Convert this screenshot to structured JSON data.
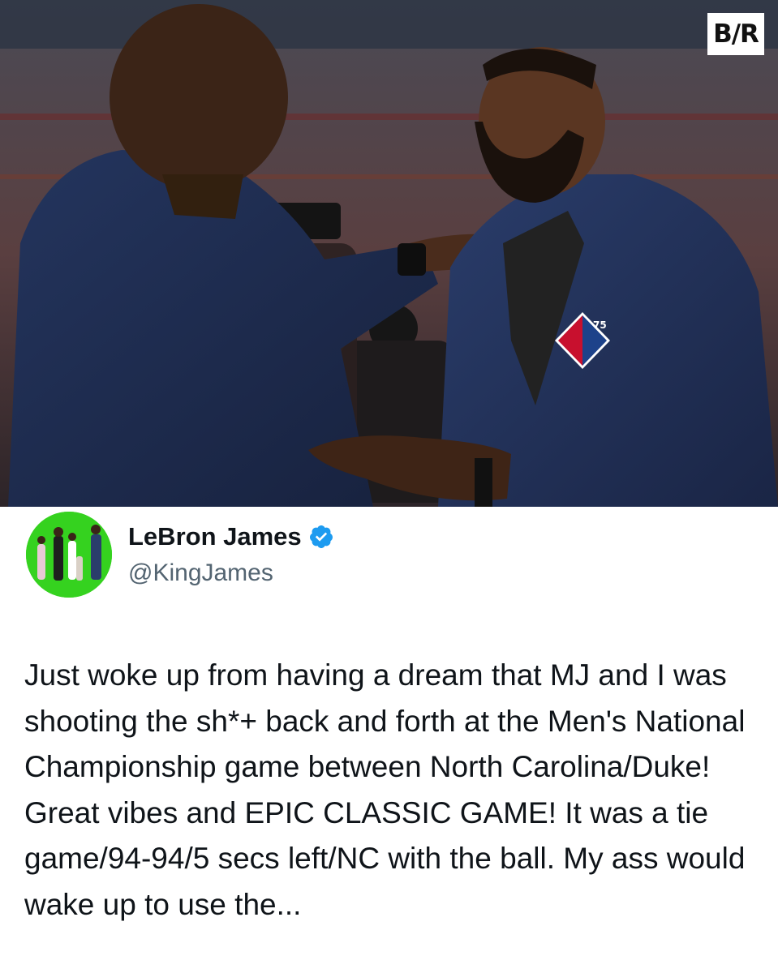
{
  "photo": {
    "watermark": "B/R",
    "patch": "75"
  },
  "tweet": {
    "display_name": "LeBron James",
    "handle": "@KingJames",
    "text": "Just woke up from having a dream that MJ and I was shooting the sh*+ back and forth at the Men's National Championship game between North Carolina/Duke! Great vibes and EPIC CLASSIC GAME! It was a tie game/94-94/5 secs left/NC with the ball. My ass would wake up to use the..."
  },
  "icons": {
    "verified": "verified-badge-icon",
    "avatar": "profile-avatar"
  },
  "colors": {
    "verified": "#1d9bf0",
    "avatar_bg": "#35d21f",
    "text": "#0f1419",
    "handle": "#536471"
  }
}
